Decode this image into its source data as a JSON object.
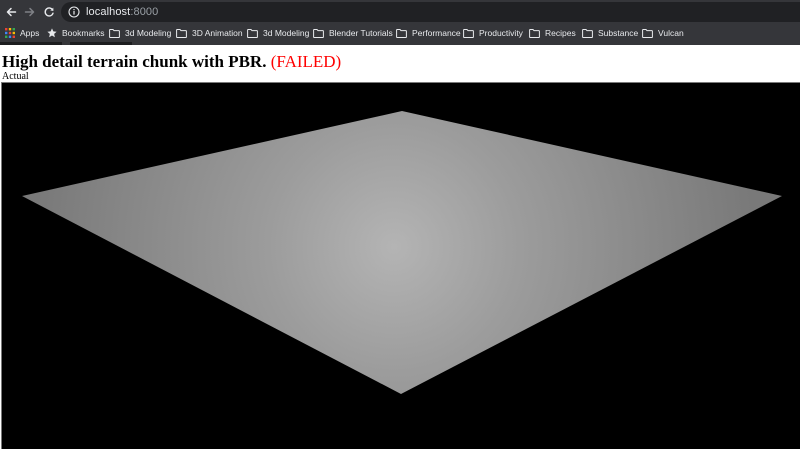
{
  "browser": {
    "url_host": "localhost",
    "url_port": ":8000",
    "bookmarks": [
      {
        "label": "Apps",
        "icon": "apps-grid-icon"
      },
      {
        "label": "Bookmarks",
        "icon": "star-icon"
      },
      {
        "label": "3d Modeling",
        "icon": "folder-icon"
      },
      {
        "label": "3D Animation",
        "icon": "folder-icon"
      },
      {
        "label": "3d Modeling",
        "icon": "folder-icon"
      },
      {
        "label": "Blender Tutorials",
        "icon": "folder-icon"
      },
      {
        "label": "Performance",
        "icon": "folder-icon"
      },
      {
        "label": "Productivity",
        "icon": "folder-icon"
      },
      {
        "label": "Recipes",
        "icon": "folder-icon"
      },
      {
        "label": "Substance",
        "icon": "folder-icon"
      },
      {
        "label": "Vulcan",
        "icon": "folder-icon"
      }
    ]
  },
  "page": {
    "title": "High detail terrain chunk with PBR.",
    "status": "(FAILED)",
    "section_label": "Actual"
  },
  "colors": {
    "chrome_bg": "#35363a",
    "omnibox_bg": "#202124",
    "failed_red": "#ff0000",
    "viewport_bg": "#000000",
    "plane_center": "#b4b4b4",
    "plane_edge": "#7a7a7a"
  }
}
